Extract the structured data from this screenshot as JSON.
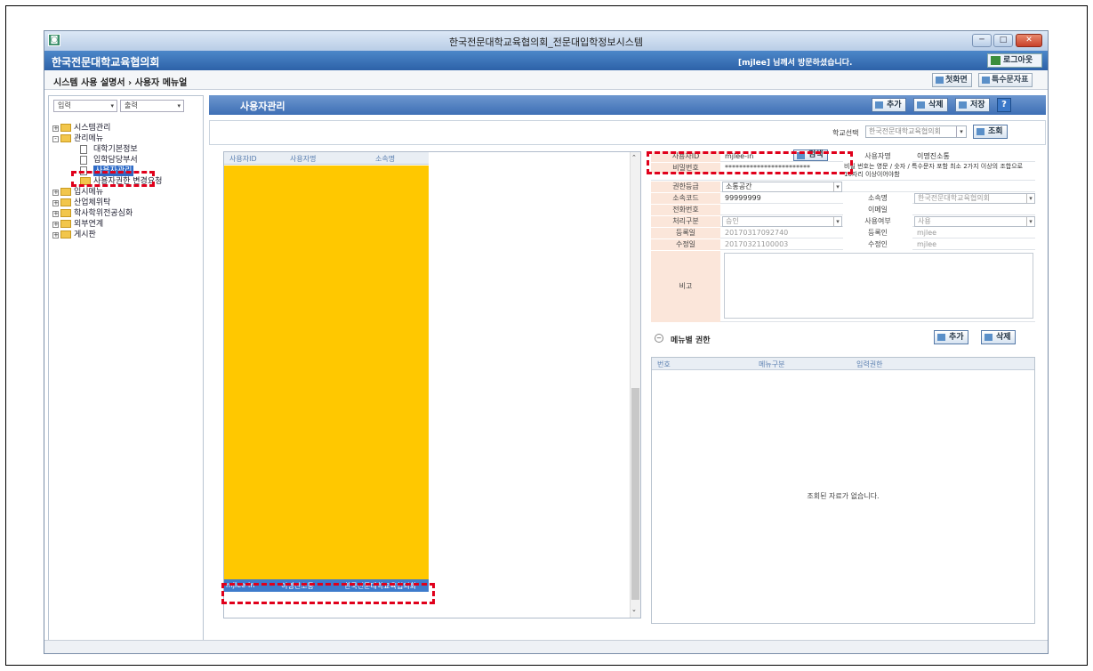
{
  "window": {
    "title": "한국전문대학교육협의회_전문대입학정보시스템",
    "app_name": "한국전문대학교육협의회",
    "welcome": "[mjlee] 님께서 방문하셨습니다.",
    "logout": "로그아웃",
    "min": "─",
    "max": "□",
    "close": "✕"
  },
  "nav": {
    "breadcrumb": "시스템 사용 설명서  ›  사용자 메뉴얼",
    "first_screen": "첫화면",
    "special_char": "특수문자표"
  },
  "sidebar": {
    "select_left": "입력",
    "select_right": "출력",
    "tree": [
      {
        "label": "시스템관리",
        "level": 0,
        "type": "folder",
        "toggle": "+"
      },
      {
        "label": "관리메뉴",
        "level": 0,
        "type": "folder",
        "toggle": "-"
      },
      {
        "label": "대학기본정보",
        "level": 1,
        "type": "doc"
      },
      {
        "label": "입학담당부서",
        "level": 1,
        "type": "doc"
      },
      {
        "label": "사용자관리",
        "level": 1,
        "type": "doc",
        "selected": true
      },
      {
        "label": "사용자권한 변경요청",
        "level": 1,
        "type": "folder"
      },
      {
        "label": "입시메뉴",
        "level": 0,
        "type": "folder",
        "toggle": "+"
      },
      {
        "label": "산업체위탁",
        "level": 0,
        "type": "folder",
        "toggle": "+"
      },
      {
        "label": "학사학위전공심화",
        "level": 0,
        "type": "folder",
        "toggle": "+"
      },
      {
        "label": "외부연계",
        "level": 0,
        "type": "folder",
        "toggle": "+"
      },
      {
        "label": "게시판",
        "level": 0,
        "type": "folder",
        "toggle": "+"
      }
    ]
  },
  "main": {
    "title": "사용자관리",
    "buttons": {
      "add": "추가",
      "delete": "삭제",
      "save": "저장",
      "help": "?"
    },
    "search": {
      "label": "학교선택",
      "value": "한국전문대학교육협의회",
      "button": "조회"
    },
    "grid": {
      "columns": [
        "사용자ID",
        "사용자명",
        "소속명"
      ],
      "rows": [
        {
          "id": "mjlee-in",
          "name": "이명진소통",
          "org": "한국전문대학교육협의회"
        }
      ]
    },
    "form": {
      "user_id_label": "사용자ID",
      "user_id": "mjlee-in",
      "search_button": "검색",
      "user_name_label": "사용자명",
      "user_name": "이명진소통",
      "password_label": "비밀번호",
      "password": "************************",
      "password_hint": "비밀 번호는 영문 / 숫자 / 특수문자 포함 최소 2가지 이상의 조합으로 10자리 이상이어야함",
      "auth_label": "권한등급",
      "auth_value": "소통공간",
      "code_label": "소속코드",
      "code_value": "99999999",
      "org_label": "소속명",
      "org_value": "한국전문대학교육협의회",
      "phone_label": "전화번호",
      "email_label": "이메일",
      "process_label": "처리구분",
      "process_value": "승인",
      "use_label": "사용여부",
      "use_value": "사용",
      "reg_date_label": "등록일",
      "reg_date": "20170317092740",
      "reg_user_label": "등록인",
      "reg_user": "mjlee",
      "mod_date_label": "수정일",
      "mod_date": "20170321100003",
      "mod_user_label": "수정인",
      "mod_user": "mjlee",
      "memo_label": "비고"
    },
    "permissions": {
      "title": "메뉴별 권한",
      "add": "추가",
      "delete": "삭제",
      "columns": [
        "번호",
        "메뉴구분",
        "입력권한"
      ],
      "empty": "조회된 자료가 없습니다."
    }
  }
}
